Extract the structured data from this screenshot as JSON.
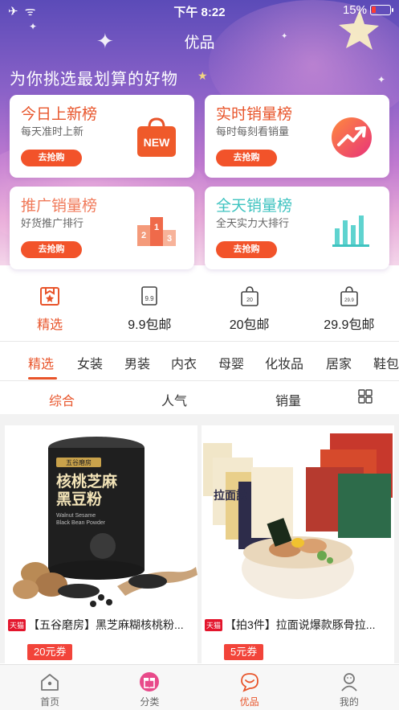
{
  "status_bar": {
    "time": "下午 8:22",
    "battery": "15%"
  },
  "header": {
    "title": "优品",
    "subtitle": "为你挑选最划算的好物"
  },
  "rank_cards": [
    {
      "title": "今日上新榜",
      "subtitle": "每天准时上新",
      "button": "去抢购",
      "icon_text": "NEW",
      "title_color": "#e8542a",
      "icon": "shopping-bag-new-icon"
    },
    {
      "title": "实时销量榜",
      "subtitle": "每时每刻看销量",
      "button": "去抢购",
      "title_color": "#e8542a",
      "icon": "trending-up-icon"
    },
    {
      "title": "推广销量榜",
      "subtitle": "好货推广排行",
      "button": "去抢购",
      "title_color": "#f07a5a",
      "icon": "podium-icon",
      "podium": [
        "2",
        "1",
        "3"
      ]
    },
    {
      "title": "全天销量榜",
      "subtitle": "全天实力大排行",
      "button": "去抢购",
      "title_color": "#3fc3c0",
      "icon": "bar-chart-icon"
    }
  ],
  "quick_nav": [
    {
      "label": "精选",
      "icon": "featured-icon",
      "active": true
    },
    {
      "label": "9.9包邮",
      "icon": "price-tag-icon",
      "icon_text": "9.9"
    },
    {
      "label": "20包邮",
      "icon": "shopping-bag-icon",
      "icon_text": "20"
    },
    {
      "label": "29.9包邮",
      "icon": "shopping-bag-icon",
      "icon_text": "29.9"
    }
  ],
  "category_tabs": [
    "精选",
    "女装",
    "男装",
    "内衣",
    "母婴",
    "化妆品",
    "居家",
    "鞋包"
  ],
  "sort_options": [
    "综合",
    "人气",
    "销量"
  ],
  "products": [
    {
      "platform": "天猫",
      "title": "【五谷磨房】黑芝麻糊核桃粉...",
      "coupon": "20元券",
      "image_text": {
        "brand": "五谷磨房",
        "name_line1": "核桃芝麻",
        "name_line2": "黑豆粉",
        "en_line1": "Walnut Sesame",
        "en_line2": "Black Bean Powder"
      }
    },
    {
      "platform": "天猫",
      "title": "【拍3件】拉面说爆款豚骨拉...",
      "coupon": "5元券",
      "image_text": {
        "brand": "拉面說"
      }
    }
  ],
  "bottom_nav": [
    {
      "label": "首页",
      "icon": "home-icon"
    },
    {
      "label": "分类",
      "icon": "gift-icon"
    },
    {
      "label": "优品",
      "icon": "chat-bubble-icon",
      "active": true
    },
    {
      "label": "我的",
      "icon": "profile-icon"
    }
  ],
  "colors": {
    "accent": "#e8542a",
    "button": "#f2532a",
    "coupon": "#f2443a",
    "tmall": "#e3152c"
  }
}
